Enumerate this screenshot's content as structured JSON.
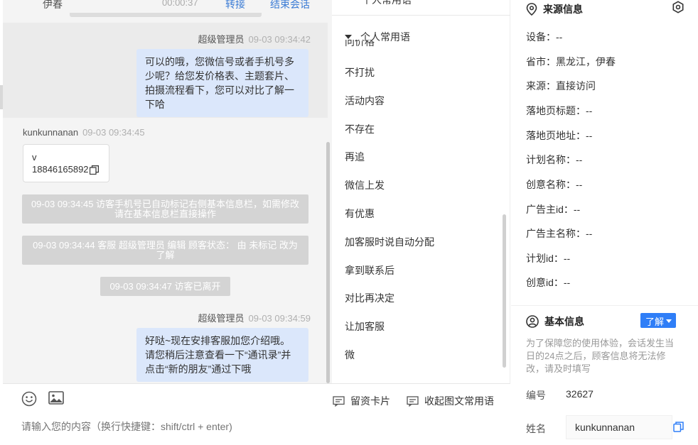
{
  "chat": {
    "top_row": {
      "name": "伊春",
      "duration": "00:00:37",
      "transfer": "转接",
      "end": "结束会话"
    },
    "messages": [
      {
        "sender": "超级管理员",
        "time": "09-03 09:34:42",
        "text": "可以的哦，您微信号或者手机号多少呢？给您发价格表、主题套片、拍摄流程看下，您可以对比了解一下哈"
      },
      {
        "sender": "kunkunnanan",
        "time": "09-03 09:34:45",
        "card_line1": "v",
        "card_line2": "18846165892"
      },
      {
        "system": "09-03 09:34:45 访客手机号已自动标记右侧基本信息栏，如需修改请在基本信息栏直接操作"
      },
      {
        "system": "09-03 09:34:44 客服 超级管理员 编辑 顾客状态： 由 未标记 改为 了解"
      },
      {
        "system": "09-03 09:34:47 访客已离开"
      },
      {
        "sender": "超级管理员",
        "time": "09-03 09:34:59",
        "text": "好哒~现在安排客服加您介绍哦。请您稍后注意查看一下“通讯录”并点击“新的朋友”通过下哦"
      }
    ]
  },
  "composer": {
    "emoji_icon": "smile-icon",
    "image_icon": "image-icon",
    "lead_card": "留资卡片",
    "rich_phrases": "收起图文常用语",
    "placeholder": "请输入您的内容（换行快捷键：shift/ctrl + enter)"
  },
  "phrases": {
    "prev_header": "个人常用语",
    "group": "个人常用语",
    "cut_item": "问价格",
    "items": [
      "不打扰",
      "活动内容",
      "不存在",
      "再追",
      "微信上发",
      "有优惠",
      "加客服时说自动分配",
      "拿到联系后",
      "对比再决定",
      "让加客服",
      "微"
    ]
  },
  "info": {
    "source_title": "来源信息",
    "source_fields": [
      "设备：--",
      "省市：黑龙江，伊春",
      "来源：直接访问",
      "落地页标题：--",
      "落地页地址：--",
      "计划名称：--",
      "创意名称：--",
      "广告主id：--",
      "广告主名称：--",
      "计划id：--",
      "创意id：--"
    ],
    "basic_title": "基本信息",
    "learn_button": "了解",
    "notice": "为了保障您的使用体验，会话发生当日的24点之后，顾客信息将无法修改，请及时填写",
    "id_label": "编号",
    "id_value": "32627",
    "name_label": "姓名",
    "name_value": "kunkunnanan"
  },
  "colors": {
    "accent": "#2f7ef7",
    "bubble": "#dbe7fb",
    "system_bg": "#d4d4d4"
  }
}
